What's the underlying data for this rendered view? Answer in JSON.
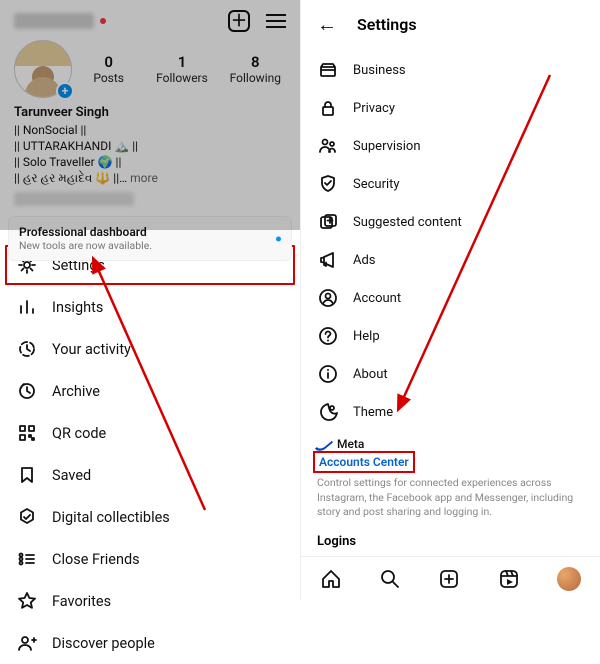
{
  "left": {
    "topbar": {
      "has_new": true
    },
    "stats": [
      {
        "n": "0",
        "l": "Posts"
      },
      {
        "n": "1",
        "l": "Followers"
      },
      {
        "n": "8",
        "l": "Following"
      }
    ],
    "bio": {
      "name": "Tarunveer Singh",
      "line1": "|| NonSocial ||",
      "line2": "|| UTTARAKHANDI 🏔️ ||",
      "line3": "|| Solo Traveller 🌍 ||",
      "line4": "|| હર હર મહાદેવ 🔱 ||…",
      "more": "more"
    },
    "dashboard": {
      "title": "Professional dashboard",
      "subtitle": "New tools are now available."
    },
    "menu": [
      {
        "icon": "gear-icon",
        "label": "Settings",
        "highlight": true
      },
      {
        "icon": "bar-chart-icon",
        "label": "Insights"
      },
      {
        "icon": "clock-icon",
        "label": "Your activity"
      },
      {
        "icon": "archive-icon",
        "label": "Archive"
      },
      {
        "icon": "qr-icon",
        "label": "QR code"
      },
      {
        "icon": "bookmark-icon",
        "label": "Saved"
      },
      {
        "icon": "hexagon-icon",
        "label": "Digital collectibles"
      },
      {
        "icon": "close-friends-icon",
        "label": "Close Friends"
      },
      {
        "icon": "star-icon",
        "label": "Favorites"
      },
      {
        "icon": "discover-icon",
        "label": "Discover people"
      }
    ]
  },
  "right": {
    "title": "Settings",
    "items": [
      {
        "icon": "business-icon",
        "label": "Business"
      },
      {
        "icon": "lock-icon",
        "label": "Privacy"
      },
      {
        "icon": "supervision-icon",
        "label": "Supervision"
      },
      {
        "icon": "shield-icon",
        "label": "Security"
      },
      {
        "icon": "suggested-icon",
        "label": "Suggested content"
      },
      {
        "icon": "megaphone-icon",
        "label": "Ads"
      },
      {
        "icon": "account-icon",
        "label": "Account"
      },
      {
        "icon": "help-icon",
        "label": "Help"
      },
      {
        "icon": "about-icon",
        "label": "About"
      },
      {
        "icon": "theme-icon",
        "label": "Theme"
      }
    ],
    "meta_brand": "Meta",
    "accounts_center": "Accounts Center",
    "accounts_desc": "Control settings for connected experiences across Instagram, the Facebook app and Messenger, including story and post sharing and logging in.",
    "logins": "Logins",
    "tabbar": [
      "home-icon",
      "search-icon",
      "create-icon",
      "reels-icon",
      "avatar-icon"
    ]
  }
}
